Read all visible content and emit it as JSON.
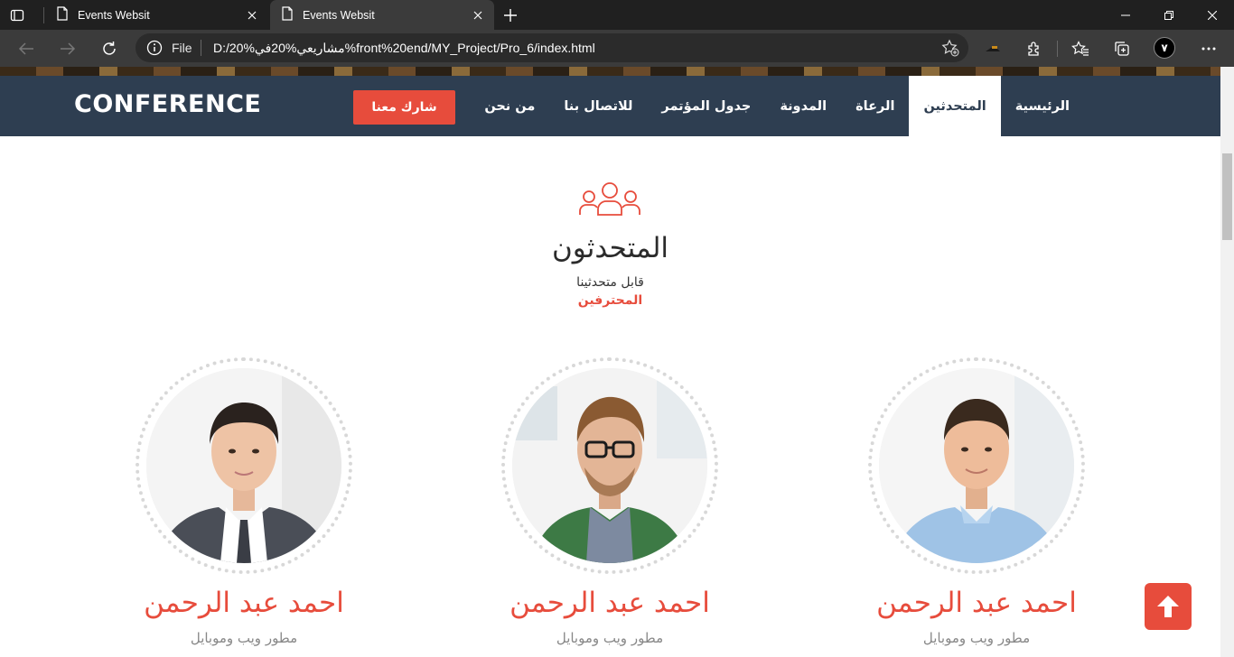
{
  "browser": {
    "tabs": [
      {
        "title": "Events Websit",
        "active": false
      },
      {
        "title": "Events Websit",
        "active": true
      }
    ],
    "address": {
      "scheme_label": "File",
      "url": "D:/20%مشاريعي%20في%front%20end/MY_Project/Pro_6/index.html"
    },
    "profile_initial": "٧"
  },
  "navbar": {
    "logo": "CONFERENCE",
    "join_button": "شارك معنا",
    "items": [
      {
        "label": "الرئيسية",
        "active": false
      },
      {
        "label": "المتحدثين",
        "active": true
      },
      {
        "label": "الرعاة",
        "active": false
      },
      {
        "label": "المدونة",
        "active": false
      },
      {
        "label": "جدول المؤتمر",
        "active": false
      },
      {
        "label": "للاتصال بنا",
        "active": false
      },
      {
        "label": "من نحن",
        "active": false
      }
    ]
  },
  "speakers_section": {
    "icon": "users-icon",
    "title": "المتحدثون",
    "subtitle": "قابل متحدثينا",
    "highlight": "المحترفين",
    "speakers": [
      {
        "name": "احمد عبد الرحمن",
        "role": "مطور ويب وموبايل"
      },
      {
        "name": "احمد عبد الرحمن",
        "role": "مطور ويب وموبايل"
      },
      {
        "name": "احمد عبد الرحمن",
        "role": "مطور ويب وموبايل"
      }
    ]
  },
  "colors": {
    "accent": "#e74c3c",
    "navbar": "#2e3e51",
    "chrome_dark": "#202020",
    "chrome_bar": "#3b3b3b"
  }
}
